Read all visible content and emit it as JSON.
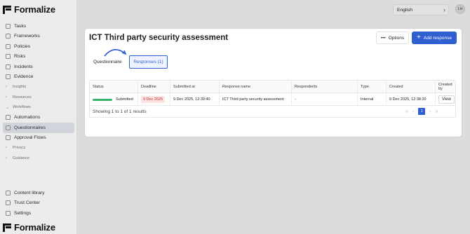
{
  "brand": {
    "name": "Formalize"
  },
  "sidebar": {
    "items": [
      {
        "label": "Tasks"
      },
      {
        "label": "Frameworks"
      },
      {
        "label": "Policies"
      },
      {
        "label": "Risks"
      },
      {
        "label": "Incidents"
      },
      {
        "label": "Evidence"
      }
    ],
    "groups": {
      "insights": "Insights",
      "resources": "Resources",
      "workflows": "Workflows"
    },
    "workflow_items": [
      {
        "label": "Automations"
      },
      {
        "label": "Questionnaires",
        "active": true
      },
      {
        "label": "Approval Flows"
      }
    ],
    "groups2": {
      "privacy": "Privacy",
      "guidance": "Guidance"
    },
    "bottom_items": [
      {
        "label": "Content library"
      },
      {
        "label": "Trust Center"
      },
      {
        "label": "Settings"
      }
    ]
  },
  "topbar": {
    "language": "English",
    "avatar_initials": "LH"
  },
  "page": {
    "title": "ICT Third party security assessment",
    "options_label": "Options",
    "add_response_label": "Add response",
    "tabs": {
      "questionnaire": "Questionnaire",
      "responses": "Responses (1)"
    }
  },
  "table": {
    "columns": [
      "Status",
      "Deadline",
      "Submitted at",
      "Response name",
      "Respondents",
      "Type",
      "Created",
      "Created by"
    ],
    "rows": [
      {
        "status": "Submitted",
        "deadline": "9 Dec 2025",
        "submitted_at": "9 Dec 2025, 12:39:40",
        "response_name": "ICT Third party security assessment",
        "respondents": "-",
        "type": "Internal",
        "created": "9 Dec 2025, 12:38:20",
        "action": "View"
      }
    ],
    "showing": "Showing 1 to 1 of 1 results",
    "current_page": "1"
  },
  "colors": {
    "accent": "#2f5fd1",
    "status_submitted": "#37b26a",
    "deadline_bg": "#fde2e2"
  }
}
